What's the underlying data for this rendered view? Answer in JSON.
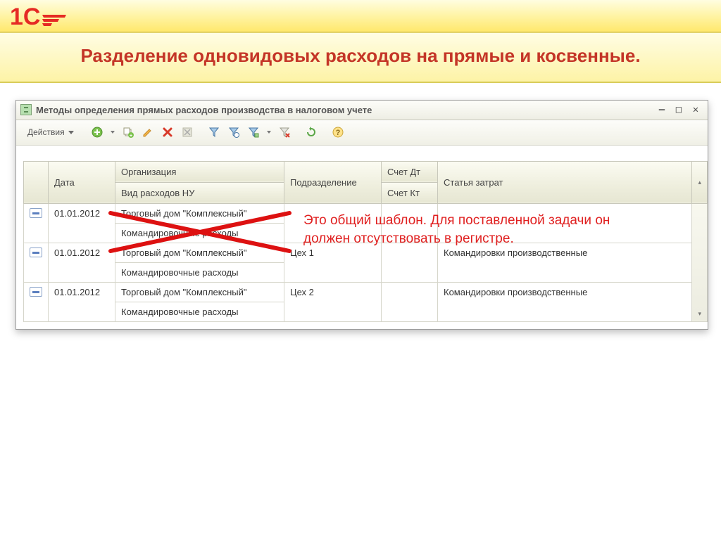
{
  "slide_title": "Разделение одновидовых расходов на прямые и косвенные.",
  "window": {
    "title": "Методы определения прямых расходов производства в налоговом учете"
  },
  "toolbar": {
    "actions_label": "Действия"
  },
  "columns": {
    "date": "Дата",
    "org": "Организация",
    "exp_type": "Вид расходов НУ",
    "subdivision": "Подразделение",
    "acct_dt": "Счет Дт",
    "acct_kt": "Счет Кт",
    "cost_item": "Статья затрат"
  },
  "rows": [
    {
      "date": "01.01.2012",
      "org": "Торговый дом \"Комплексный\"",
      "exp_type": "Командировочные расходы",
      "subdivision": "",
      "cost_item": ""
    },
    {
      "date": "01.01.2012",
      "org": "Торговый дом \"Комплексный\"",
      "exp_type": "Командировочные расходы",
      "subdivision": "Цех 1",
      "cost_item": "Командировки производственные"
    },
    {
      "date": "01.01.2012",
      "org": "Торговый дом \"Комплексный\"",
      "exp_type": "Командировочные расходы",
      "subdivision": "Цех 2",
      "cost_item": "Командировки производственные"
    }
  ],
  "annotation": "Это общий шаблон. Для поставленной задачи он должен отсутствовать в регистре."
}
